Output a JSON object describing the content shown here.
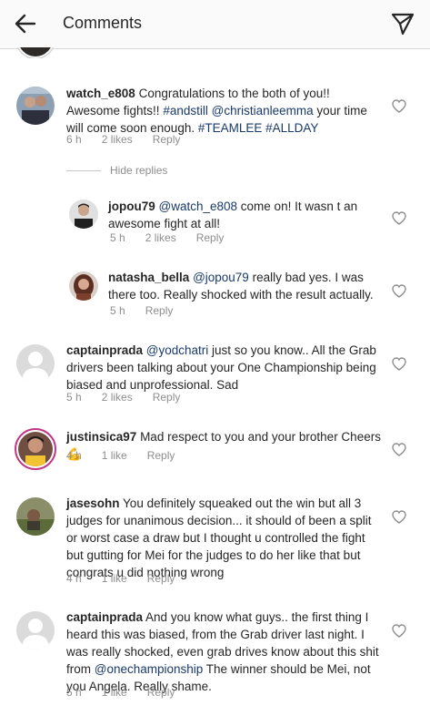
{
  "header": {
    "title": "Comments"
  },
  "hide_replies": "Hide replies",
  "comments": [
    {
      "user": "watch_e808",
      "text_parts": [
        {
          "t": "Congratulations to the both of you!! Awesome fights!! ",
          "m": false
        },
        {
          "t": "#andstill",
          "m": true
        },
        {
          "t": " ",
          "m": false
        },
        {
          "t": "@christianleemma",
          "m": true
        },
        {
          "t": " your time will come soon enough.  ",
          "m": false
        },
        {
          "t": "#TEAMLEE",
          "m": true
        },
        {
          "t": " ",
          "m": false
        },
        {
          "t": "#ALLDAY",
          "m": true
        }
      ],
      "time": "6 h",
      "likes": "2 likes",
      "reply": "Reply"
    },
    {
      "user": "jopou79",
      "text_parts": [
        {
          "t": "@watch_e808",
          "m": true
        },
        {
          "t": " come on! It wasn t an awesome fight at all!",
          "m": false
        }
      ],
      "time": "5 h",
      "likes": "2 likes",
      "reply": "Reply"
    },
    {
      "user": "natasha_bella",
      "text_parts": [
        {
          "t": "@jopou79",
          "m": true
        },
        {
          "t": " really bad yes. I was there too. Really shocked with the result actually.",
          "m": false
        }
      ],
      "time": "5 h",
      "likes": "",
      "reply": "Reply"
    },
    {
      "user": "captainprada",
      "text_parts": [
        {
          "t": "@yodchatri",
          "m": true
        },
        {
          "t": " just so you know.. All the Grab drivers been talking about your One Championship being biased and unprofessional. Sad",
          "m": false
        }
      ],
      "time": "5 h",
      "likes": "2 likes",
      "reply": "Reply"
    },
    {
      "user": "justinsica97",
      "text_parts": [
        {
          "t": "Mad respect to you and your brother Cheers 💪",
          "m": false
        }
      ],
      "time": "4 h",
      "likes": "1 like",
      "reply": "Reply"
    },
    {
      "user": "jasesohn",
      "text_parts": [
        {
          "t": "You definitely squeaked out the win but all 3 judges for unanimous decision... it should of been a split or worst case a draw but I thought u controlled the fight but gutting for Mei for the judges to do her like that but congrats u did nothing wrong",
          "m": false
        }
      ],
      "time": "4 h",
      "likes": "1 like",
      "reply": "Reply"
    },
    {
      "user": "captainprada",
      "text_parts": [
        {
          "t": "And you know what guys.. the first thing I heard this was biased, from the Grab driver last night. I was really shocked, even grab drives know about this shit from ",
          "m": false
        },
        {
          "t": "@onechampionship",
          "m": true
        },
        {
          "t": " The winner should be Mei, not you Angela. Really shame.",
          "m": false
        }
      ],
      "time": "5 h",
      "likes": "1 like",
      "reply": "Reply"
    }
  ]
}
